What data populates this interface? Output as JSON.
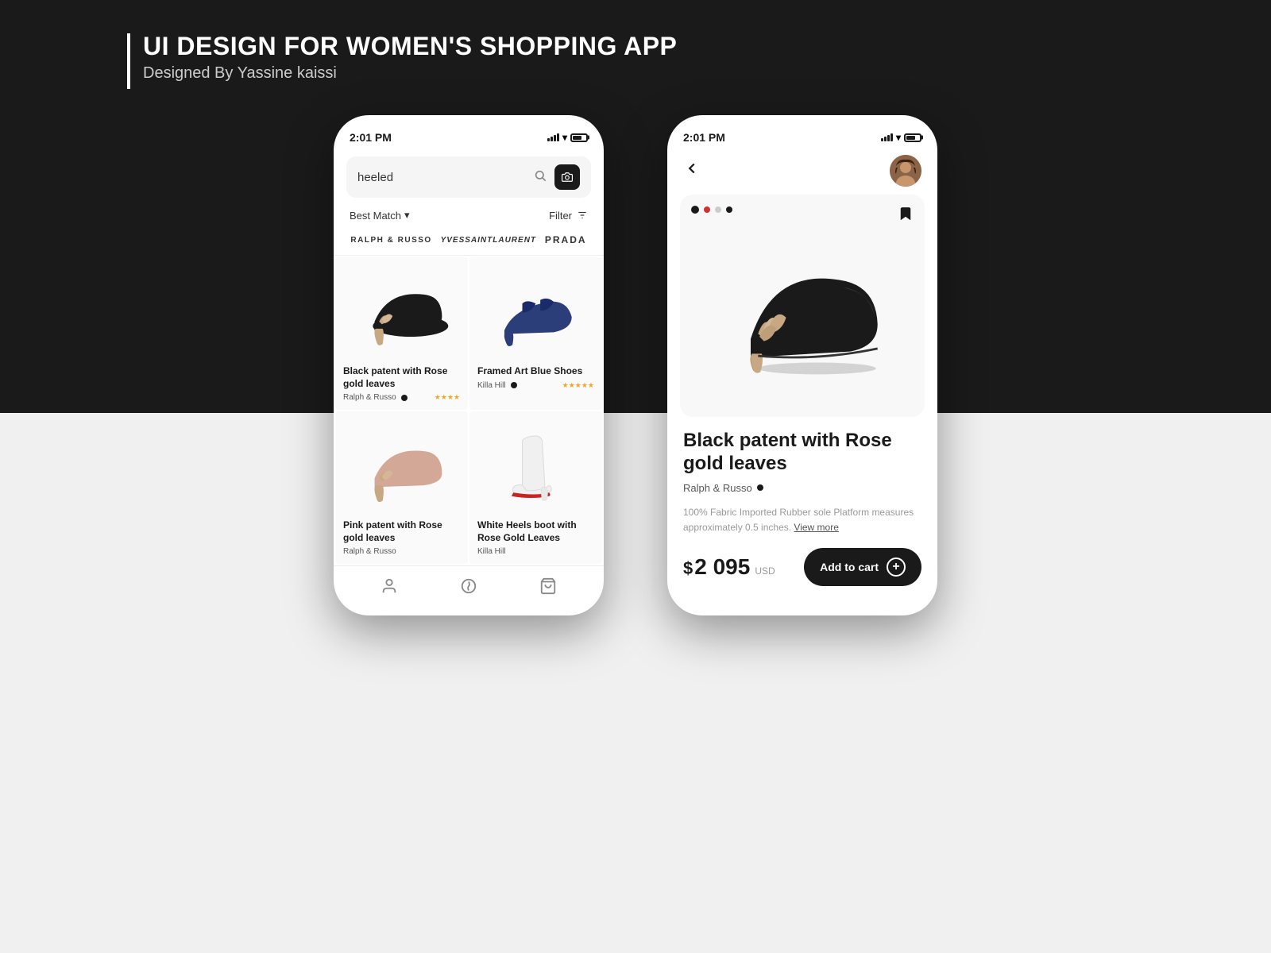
{
  "header": {
    "bar_decoration": true,
    "title": "UI DESIGN FOR WOMEN'S SHOPPING APP",
    "subtitle": "Designed By Yassine kaissi"
  },
  "phone1": {
    "status": {
      "time": "2:01 PM"
    },
    "search": {
      "value": "heeled",
      "placeholder": "Search"
    },
    "sort_label": "Best Match",
    "filter_label": "Filter",
    "brands": [
      {
        "name": "RALPH & RUSSO"
      },
      {
        "name": "YvesSaintLaurent"
      },
      {
        "name": "PRADA"
      }
    ],
    "products": [
      {
        "name": "Black patent with Rose gold leaves",
        "brand": "Ralph & Russo",
        "stars": "★★★★",
        "verified": true
      },
      {
        "name": "Framed Art Blue Shoes",
        "brand": "Killa Hill",
        "stars": "★★★★★",
        "verified": true
      },
      {
        "name": "Pink patent with Rose gold leaves",
        "brand": "Ralph & Russo",
        "stars": "",
        "verified": false
      },
      {
        "name": "White Heels boot with Rose Gold Leaves",
        "brand": "Killa Hill",
        "stars": "",
        "verified": false
      }
    ],
    "nav": {
      "items": [
        "profile",
        "trending",
        "cart"
      ]
    }
  },
  "phone2": {
    "status": {
      "time": "2:01 PM"
    },
    "product": {
      "title": "Black patent with Rose gold leaves",
      "brand": "Ralph & Russo",
      "verified": true,
      "description": "100% Fabric Imported Rubber sole Platform measures approximately 0.5 inches.",
      "view_more": "View more",
      "price_symbol": "$",
      "price": "2 095",
      "currency": "USD",
      "add_to_cart_label": "Add to cart"
    },
    "carousel_dots": 4
  }
}
